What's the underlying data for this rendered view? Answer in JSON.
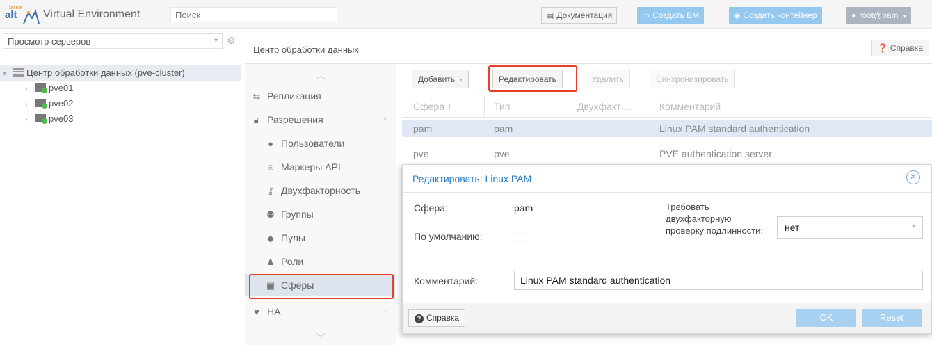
{
  "header": {
    "logo_text_top": "base",
    "logo_text": "alt",
    "app_title": "Virtual Environment",
    "search_placeholder": "Поиск",
    "docs_label": "Документация",
    "create_vm_label": "Создать ВМ",
    "create_ct_label": "Создать контейнер",
    "user_label": "root@pam"
  },
  "tree": {
    "view_label": "Просмотр серверов",
    "datacenter_label": "Центр обработки данных (pve-cluster)",
    "nodes": [
      "pve01",
      "pve02",
      "pve03"
    ]
  },
  "content_header": {
    "breadcrumb": "Центр обработки данных",
    "help_label": "Справка"
  },
  "nav": {
    "items": [
      {
        "label": "Репликация",
        "icon": "replication-icon"
      },
      {
        "label": "Разрешения",
        "icon": "unlock-icon"
      },
      {
        "label": "Пользователи",
        "icon": "user-icon"
      },
      {
        "label": "Маркеры API",
        "icon": "api-token-icon"
      },
      {
        "label": "Двухфакторность",
        "icon": "key-icon"
      },
      {
        "label": "Группы",
        "icon": "group-icon"
      },
      {
        "label": "Пулы",
        "icon": "tags-icon"
      },
      {
        "label": "Роли",
        "icon": "role-icon"
      },
      {
        "label": "Сферы",
        "icon": "address-book-icon"
      },
      {
        "label": "HA",
        "icon": "heartbeat-icon"
      }
    ],
    "selected": "Сферы"
  },
  "toolbar": {
    "add_label": "Добавить",
    "edit_label": "Редактировать",
    "delete_label": "Удалить",
    "sync_label": "Синхронизировать"
  },
  "grid": {
    "columns": [
      "Сфера ↑",
      "Тип",
      "Двухфакт…",
      "Комментарий"
    ],
    "rows": [
      {
        "realm": "pam",
        "type": "pam",
        "tfa": "",
        "comment": "Linux PAM standard authentication"
      },
      {
        "realm": "pve",
        "type": "pve",
        "tfa": "",
        "comment": "PVE authentication server"
      }
    ]
  },
  "dialog": {
    "title": "Редактировать: Linux PAM",
    "realm_label": "Сфера:",
    "realm_value": "pam",
    "default_label": "По умолчанию:",
    "default_checked": false,
    "tfa_label": "Требовать двухфакторную проверку подлинности:",
    "tfa_value": "нет",
    "comment_label": "Комментарий:",
    "comment_value": "Linux PAM standard authentication",
    "help_label": "Справка",
    "ok_label": "OK",
    "reset_label": "Reset"
  },
  "colors": {
    "accent": "#2a7fbf",
    "highlight_border": "#e8402a",
    "button_blue": "#95c8ef",
    "selection": "#dde4ed"
  }
}
